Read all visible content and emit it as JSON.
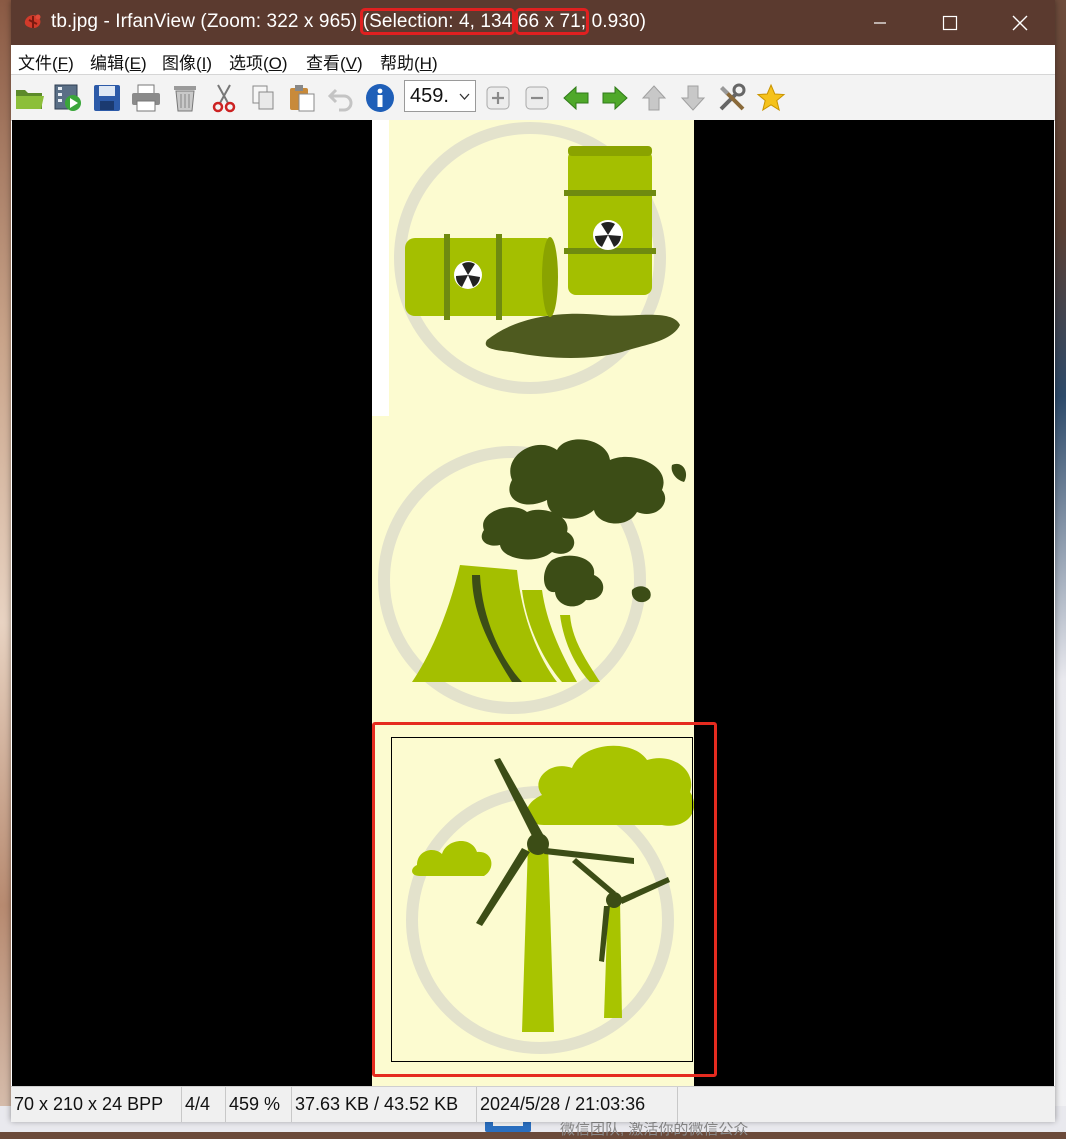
{
  "window": {
    "title_prefix": "tb.jpg - IrfanView (Zoom: 322 x 965) ",
    "title_selection": "(Selection: 4, 134",
    "title_sep": " ",
    "title_size": "66 x 71;",
    "title_suffix": " 0.930)"
  },
  "menu": [
    {
      "label": "文件(",
      "key": "F",
      "end": ")"
    },
    {
      "label": "编辑(",
      "key": "E",
      "end": ")"
    },
    {
      "label": "图像(",
      "key": "I",
      "end": ")"
    },
    {
      "label": "选项(",
      "key": "O",
      "end": ")"
    },
    {
      "label": "查看(",
      "key": "V",
      "end": ")"
    },
    {
      "label": "帮助(",
      "key": "H",
      "end": ")"
    }
  ],
  "toolbar": {
    "zoom_value": "459.",
    "icons": [
      "open-folder-icon",
      "slideshow-icon",
      "save-icon",
      "print-icon",
      "delete-icon",
      "cut-icon",
      "copy-icon",
      "paste-icon",
      "undo-icon",
      "info-icon",
      "zoom-in-icon",
      "zoom-out-icon",
      "previous-arrow-icon",
      "next-arrow-icon",
      "first-arrow-icon",
      "last-arrow-icon",
      "settings-tools-icon",
      "favorites-star-icon"
    ]
  },
  "status": {
    "dimensions": "70 x 210 x 24 BPP",
    "index": "4/4",
    "zoom": "459 %",
    "filesize": "37.63 KB / 43.52 KB",
    "datetime": "2024/5/28 / 21:03:36"
  },
  "desktop": {
    "taskbar_text": "微信团队, 激活你的微信公众"
  },
  "colors": {
    "titlebar": "#5b3a2f",
    "image_bg": "#fcfbd0",
    "accent_green": "#a8c400",
    "dark_green": "#3c4d16",
    "annotation_red": "#e52b1f"
  }
}
